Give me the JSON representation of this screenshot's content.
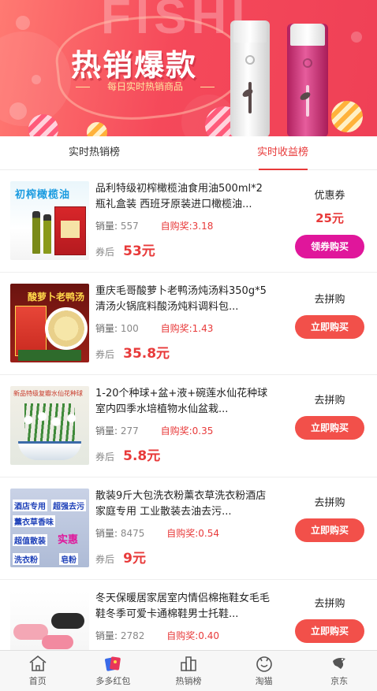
{
  "banner": {
    "headline": "热销爆款",
    "subline": "每日实时热销商品",
    "ghost_text": "FISHI"
  },
  "tabs": [
    {
      "label": "实时热销榜",
      "active": false
    },
    {
      "label": "实时收益榜",
      "active": true
    }
  ],
  "labels": {
    "sales": "销量:",
    "award": "自购奖:",
    "after_coupon": "券后"
  },
  "products": [
    {
      "title": "品利特级初榨橄榄油食用油500ml*2瓶礼盒装 西班牙原装进口橄榄油...",
      "sales": "557",
      "award": "3.18",
      "price": "53元",
      "type": "优惠券",
      "coupon": "25元",
      "button": "领券购买",
      "button_color": "#e0169b",
      "thumb_text": "初榨橄榄油"
    },
    {
      "title": "重庆毛哥酸萝卜老鸭汤炖汤料350g*5清汤火锅底料酸汤炖料调料包...",
      "sales": "100",
      "award": "1.43",
      "price": "35.8元",
      "type": "去拼购",
      "coupon": "",
      "button": "立即购买",
      "button_color": "#f2504a",
      "thumb_text": "酸萝卜老鸭汤"
    },
    {
      "title": "1-20个种球+盆+液+碗莲水仙花种球室内四季水培植物水仙盆栽...",
      "sales": "277",
      "award": "0.35",
      "price": "5.8元",
      "type": "去拼购",
      "coupon": "",
      "button": "立即购买",
      "button_color": "#f2504a",
      "thumb_text": "新品特级复瓣水仙花种球"
    },
    {
      "title": "散装9斤大包洗衣粉薰衣草洗衣粉酒店家庭专用 工业散装去油去污...",
      "sales": "8475",
      "award": "0.54",
      "price": "9元",
      "type": "去拼购",
      "coupon": "",
      "button": "立即购买",
      "button_color": "#f2504a",
      "thumb_tags": [
        "酒店专用",
        "超强去污",
        "薰衣草香味",
        "超值散装",
        "实惠",
        "洗衣粉",
        "皂粉"
      ]
    },
    {
      "title": "冬天保暖居家居室内情侣棉拖鞋女毛毛鞋冬季可爱卡通棉鞋男士托鞋...",
      "sales": "2782",
      "award": "0.40",
      "price": "",
      "type": "去拼购",
      "coupon": "",
      "button": "立即购买",
      "button_color": "#f2504a"
    }
  ],
  "nav": [
    {
      "label": "首页",
      "icon": "home-icon"
    },
    {
      "label": "多多红包",
      "icon": "red-envelope-icon"
    },
    {
      "label": "热销榜",
      "icon": "ranking-icon"
    },
    {
      "label": "淘猫",
      "icon": "tmall-icon"
    },
    {
      "label": "京东",
      "icon": "jd-icon"
    }
  ]
}
